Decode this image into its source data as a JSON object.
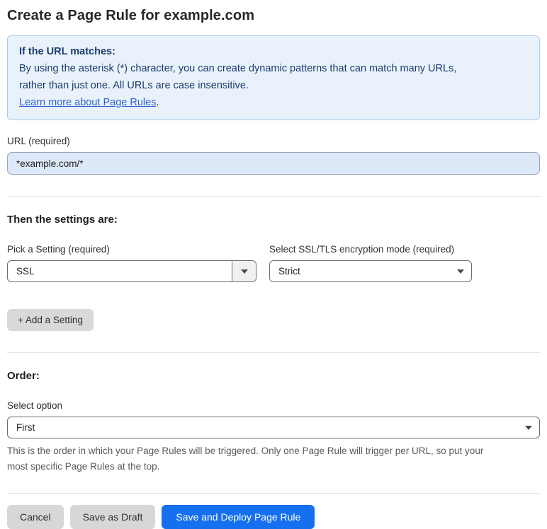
{
  "page": {
    "title": "Create a Page Rule for example.com"
  },
  "info_box": {
    "heading": "If the URL matches:",
    "body_lines": [
      "By using the asterisk (*) character, you can create dynamic patterns that can match many URLs,",
      "rather than just one. All URLs are case insensitive."
    ],
    "link_label": "Learn more about Page Rules",
    "link_suffix": "."
  },
  "url_field": {
    "label": "URL (required)",
    "value": "*example.com/*"
  },
  "settings_section": {
    "heading": "Then the settings are:",
    "pick_setting": {
      "label": "Pick a Setting (required)",
      "selected": "SSL"
    },
    "ssl_mode": {
      "label": "Select SSL/TLS encryption mode (required)",
      "selected": "Strict"
    },
    "add_setting_label": "+ Add a Setting"
  },
  "order_section": {
    "heading": "Order:",
    "select_label": "Select option",
    "selected": "First",
    "helper_lines": [
      "This is the order in which your Page Rules will be triggered. Only one Page Rule will trigger per URL, so put your",
      "most specific Page Rules at the top."
    ]
  },
  "footer": {
    "cancel_label": "Cancel",
    "save_draft_label": "Save as Draft",
    "save_deploy_label": "Save and Deploy Page Rule"
  },
  "colors": {
    "primary_button_blue": "#1570ef",
    "info_box_background": "#e9f2fb",
    "info_box_border": "#abcbec",
    "info_box_text": "#1d3b6e",
    "link_blue": "#2c62cb",
    "url_input_background": "#dde9f9"
  },
  "icons": {
    "dropdown_arrow": "caret-down"
  }
}
